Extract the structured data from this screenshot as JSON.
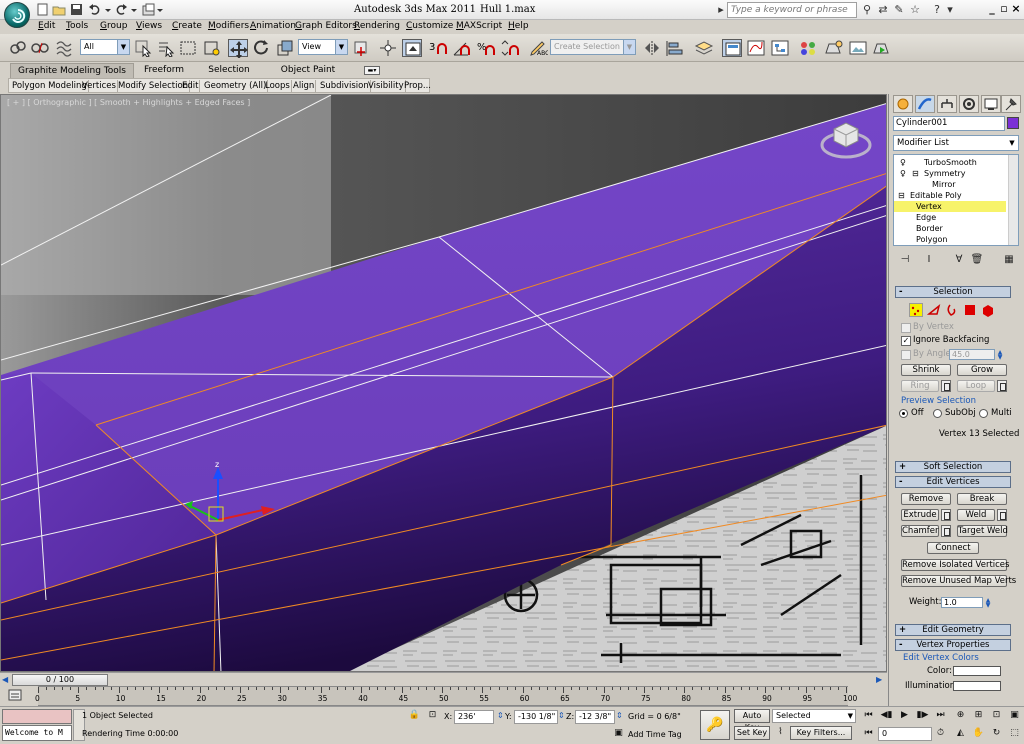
{
  "titlebar": {
    "app_title": "Autodesk 3ds Max  2011",
    "file_name": "Hull 1.max",
    "search_placeholder": "Type a keyword or phrase"
  },
  "menus": [
    "Edit",
    "Tools",
    "Group",
    "Views",
    "Create",
    "Modifiers",
    "Animation",
    "Graph Editors",
    "Rendering",
    "Customize",
    "MAXScript",
    "Help"
  ],
  "toolbar": {
    "selection_filter": "All",
    "reference_coord": "View",
    "named_selection_placeholder": "Create Selection Se"
  },
  "ribbon": {
    "tabs": [
      "Graphite Modeling Tools",
      "Freeform",
      "Selection",
      "Object Paint"
    ],
    "panels": [
      "Polygon Modeling",
      "Vertices",
      "Modify Selection",
      "Edit",
      "Geometry (All)",
      "Loops",
      "Align",
      "Subdivision",
      "Visibility",
      "Prop..."
    ]
  },
  "viewport": {
    "label": "[ + ] [ Orthographic ] [ Smooth + Highlights + Edged Faces ]",
    "gizmo_axis": "z"
  },
  "command_panel": {
    "object_name": "Cylinder001",
    "object_color": "#7b2fd6",
    "modifier_list": "Modifier List",
    "stack": [
      {
        "label": "TurboSmooth",
        "indent": 0
      },
      {
        "label": "Symmetry",
        "indent": 1
      },
      {
        "label": "Mirror",
        "indent": 2
      },
      {
        "label": "Editable Poly",
        "indent": 1
      },
      {
        "label": "Vertex",
        "indent": 2,
        "selected": true
      },
      {
        "label": "Edge",
        "indent": 2
      },
      {
        "label": "Border",
        "indent": 2
      },
      {
        "label": "Polygon",
        "indent": 2
      }
    ],
    "selection": {
      "title": "Selection",
      "by_vertex": "By Vertex",
      "ignore_backfacing": "Ignore Backfacing",
      "by_angle": "By Angle:",
      "angle_value": "45.0",
      "shrink": "Shrink",
      "grow": "Grow",
      "ring": "Ring",
      "loop": "Loop",
      "preview_selection": "Preview Selection",
      "preview_options": [
        "Off",
        "SubObj",
        "Multi"
      ],
      "status": "Vertex 13 Selected"
    },
    "soft_selection": "Soft Selection",
    "edit_vertices": {
      "title": "Edit Vertices",
      "remove": "Remove",
      "break": "Break",
      "extrude": "Extrude",
      "weld": "Weld",
      "chamfer": "Chamfer",
      "target_weld": "Target Weld",
      "connect": "Connect",
      "remove_isolated": "Remove Isolated Vertices",
      "remove_unused": "Remove Unused Map Verts",
      "weight_label": "Weight:",
      "weight_value": "1.0"
    },
    "edit_geometry": "Edit Geometry",
    "vertex_properties": {
      "title": "Vertex Properties",
      "edit_colors": "Edit Vertex Colors",
      "color": "Color:",
      "illumination": "Illumination:"
    }
  },
  "timeline": {
    "frame_label": "0 / 100",
    "ticks": [
      "0",
      "5",
      "10",
      "15",
      "20",
      "25",
      "30",
      "35",
      "40",
      "45",
      "50",
      "55",
      "60",
      "65",
      "70",
      "75",
      "80",
      "85",
      "90",
      "95",
      "100"
    ]
  },
  "status": {
    "welcome": "Welcome to M",
    "objects_selected": "1 Object Selected",
    "rendering_time": "Rendering Time  0:00:00",
    "x_label": "X:",
    "x_value": "236'",
    "y_label": "Y:",
    "y_value": "-130 1/8\"",
    "z_label": "Z:",
    "z_value": "-12 3/8\"",
    "grid": "Grid = 0 6/8\"",
    "add_time_tag": "Add Time Tag",
    "auto_key": "Auto Key",
    "set_key": "Set Key",
    "key_mode": "Selected",
    "key_filters": "Key Filters...",
    "current_frame": "0"
  }
}
